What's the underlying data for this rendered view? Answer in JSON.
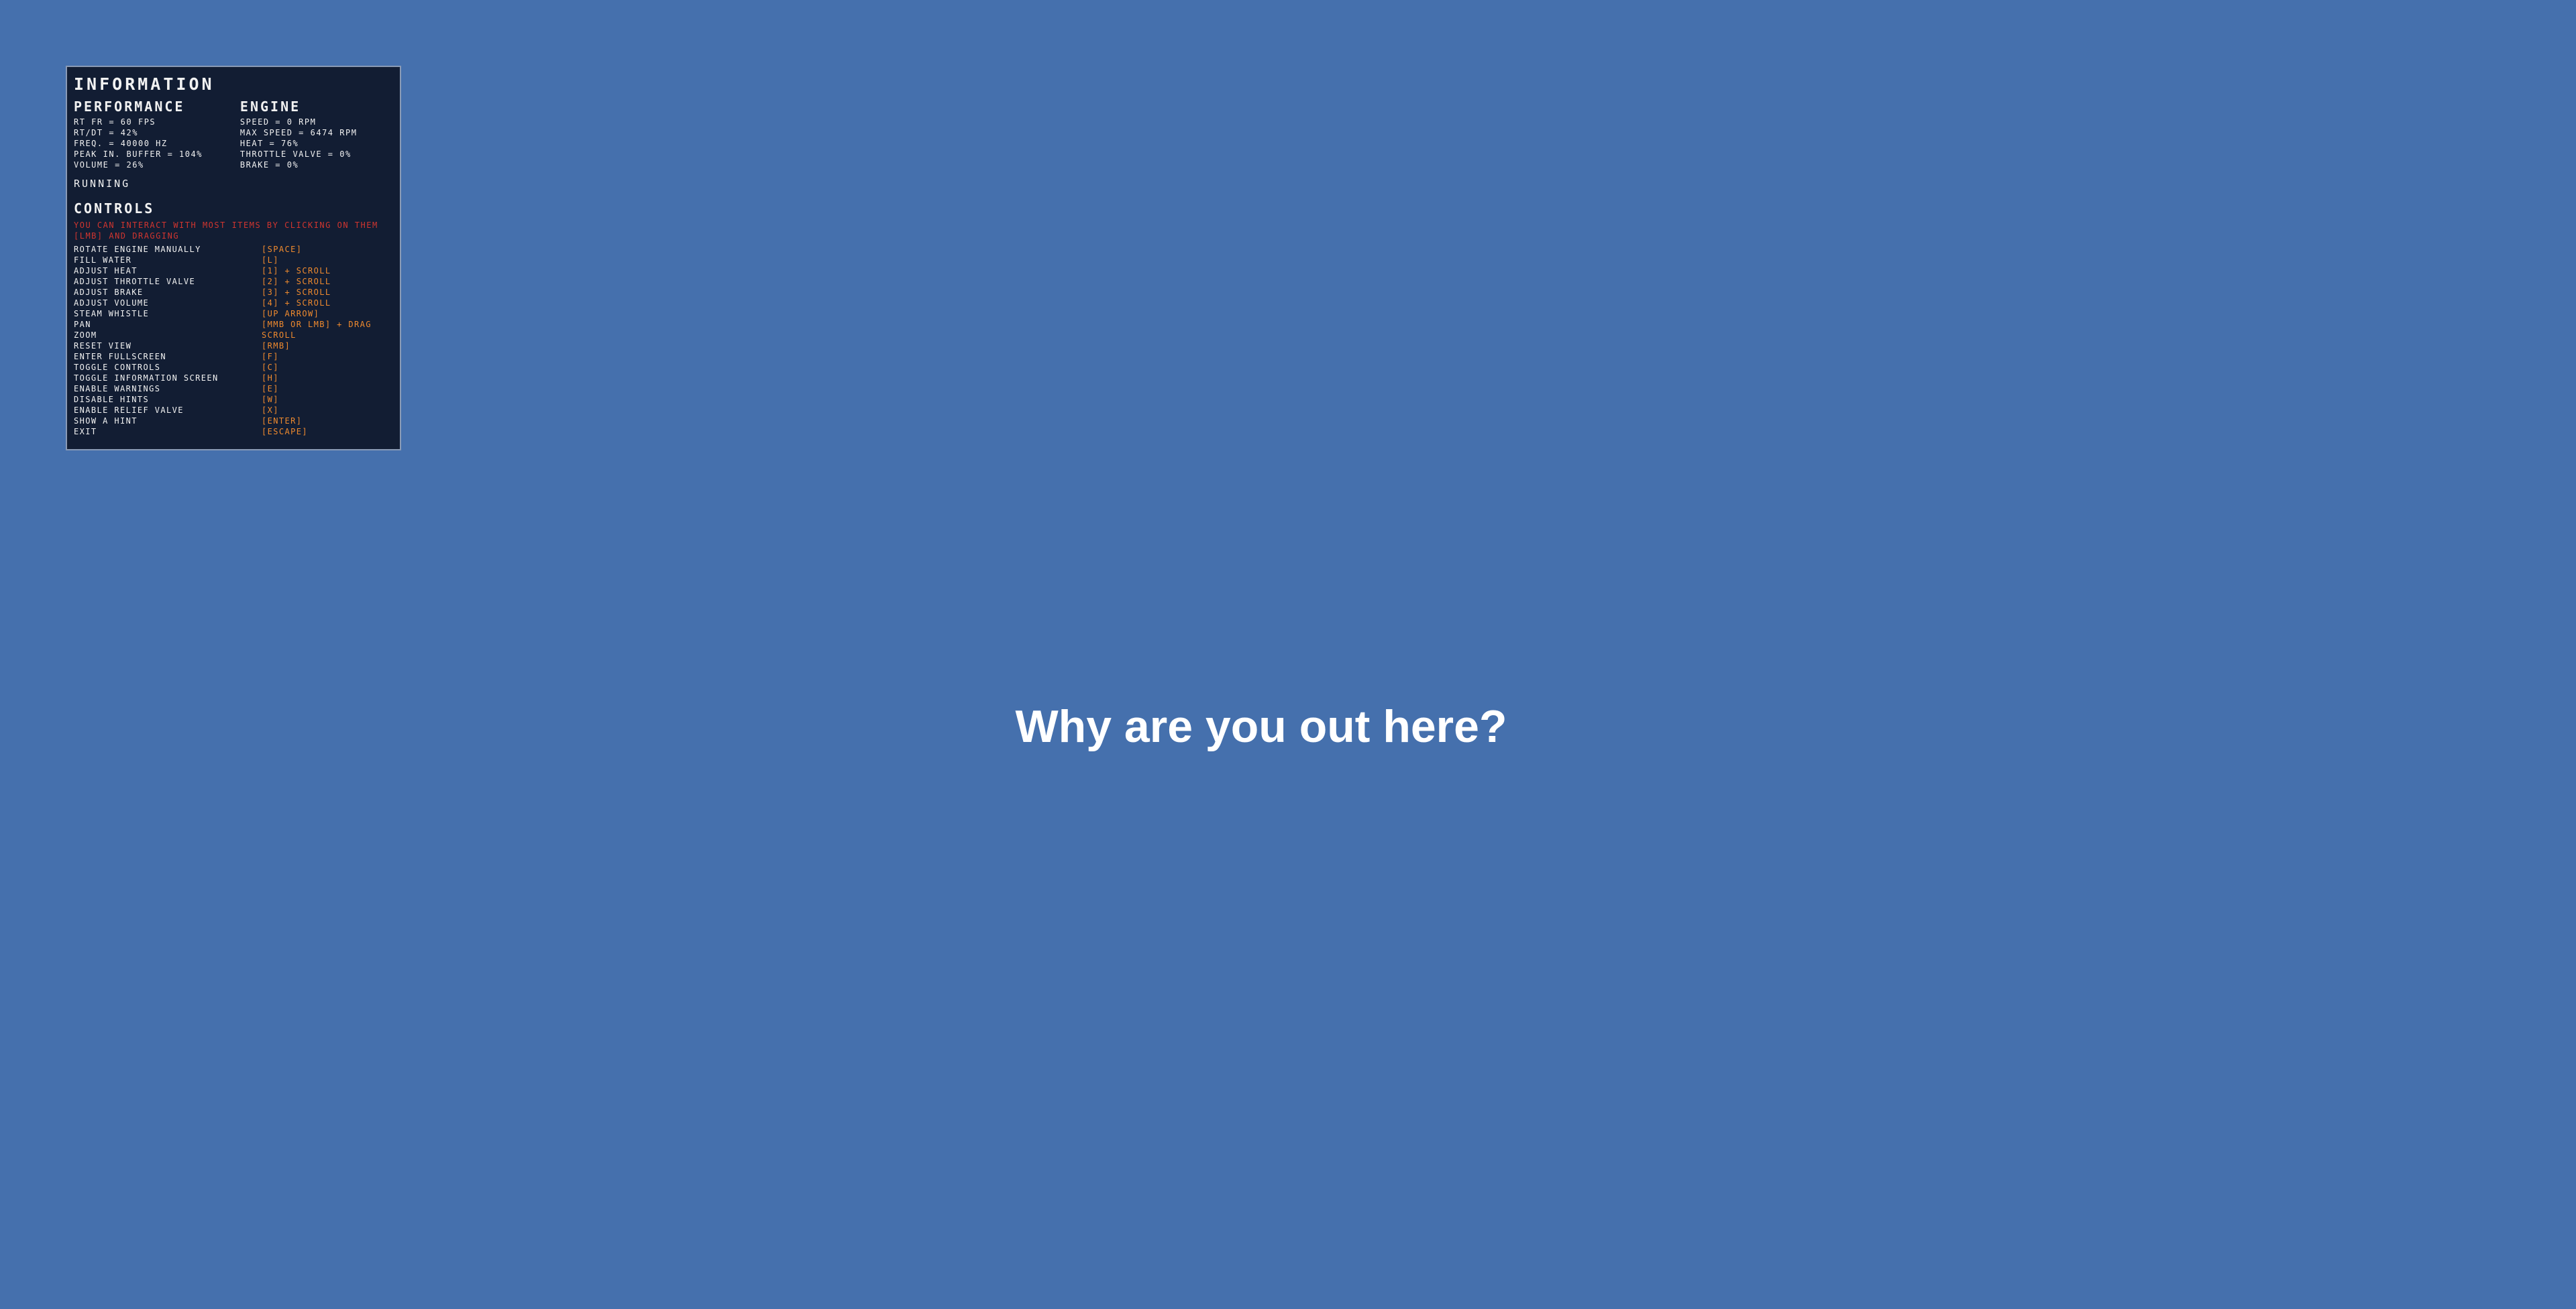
{
  "info_panel": {
    "title": "INFORMATION",
    "performance": {
      "heading": "PERFORMANCE",
      "lines": [
        "RT FR = 60 FPS",
        "RT/DT = 42%",
        "FREQ. = 40000 HZ",
        "PEAK IN. BUFFER = 104%",
        "VOLUME = 26%"
      ]
    },
    "engine": {
      "heading": "ENGINE",
      "lines": [
        "SPEED = 0 RPM",
        "MAX SPEED = 6474 RPM",
        "HEAT = 76%",
        "THROTTLE VALVE = 0%",
        "BRAKE = 0%"
      ]
    },
    "status": "RUNNING",
    "controls": {
      "heading": "CONTROLS",
      "hint": "YOU CAN INTERACT WITH MOST ITEMS BY CLICKING ON THEM [LMB] AND DRAGGING",
      "items": [
        {
          "action": "ROTATE ENGINE MANUALLY",
          "key": "[SPACE]"
        },
        {
          "action": "FILL WATER",
          "key": "[L]"
        },
        {
          "action": "ADJUST HEAT",
          "key": "[1] + SCROLL"
        },
        {
          "action": "ADJUST THROTTLE VALVE",
          "key": "[2] + SCROLL"
        },
        {
          "action": "ADJUST BRAKE",
          "key": "[3] + SCROLL"
        },
        {
          "action": "ADJUST VOLUME",
          "key": "[4] + SCROLL"
        },
        {
          "action": "STEAM WHISTLE",
          "key": "[UP ARROW]"
        },
        {
          "action": "PAN",
          "key": "[MMB OR LMB] + DRAG"
        },
        {
          "action": "ZOOM",
          "key": "SCROLL"
        },
        {
          "action": "RESET VIEW",
          "key": "[RMB]"
        },
        {
          "action": "ENTER FULLSCREEN",
          "key": "[F]"
        },
        {
          "action": "TOGGLE CONTROLS",
          "key": "[C]"
        },
        {
          "action": "TOGGLE INFORMATION SCREEN",
          "key": "[H]"
        },
        {
          "action": "ENABLE WARNINGS",
          "key": "[E]"
        },
        {
          "action": "DISABLE HINTS",
          "key": "[W]"
        },
        {
          "action": "ENABLE RELIEF VALVE",
          "key": "[X]"
        },
        {
          "action": "SHOW A HINT",
          "key": "[ENTER]"
        },
        {
          "action": "EXIT",
          "key": "[ESCAPE]"
        }
      ]
    }
  },
  "center_message": "Why are you out here?",
  "colors": {
    "background": "#4570ad",
    "panel": "#121d33",
    "hint": "#d0352f",
    "key": "#ef8a2e",
    "text": "#f2f2f2"
  }
}
